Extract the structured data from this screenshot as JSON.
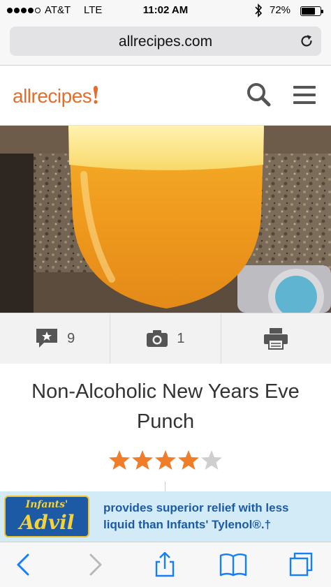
{
  "status_bar": {
    "carrier": "AT&T",
    "network": "LTE",
    "time": "11:02 AM",
    "battery_percent": "72%",
    "battery_level": 0.72,
    "signal_bars_filled": 4,
    "signal_bars_total": 5,
    "icons": [
      "signal-dots-icon",
      "bluetooth-icon",
      "battery-icon"
    ]
  },
  "browser": {
    "url": "allrecipes.com",
    "icons": [
      "reload-icon"
    ]
  },
  "site_header": {
    "logo_text": "allrecipes",
    "logo_color": "#e56d2b",
    "icons": [
      "search-icon",
      "hamburger-menu-icon"
    ]
  },
  "recipe": {
    "title": "Non-Alcoholic New Years Eve Punch",
    "rating": 4,
    "rating_max": 5,
    "star_color": "#f07d2a",
    "star_empty_color": "#cfcfcf"
  },
  "actions": {
    "reviews_count": "9",
    "photos_count": "1",
    "icons": [
      "review-icon",
      "camera-icon",
      "print-icon"
    ]
  },
  "ad": {
    "brand_top": "Infants'",
    "brand": "Advil",
    "line1": "provides superior relief with less",
    "line2": "liquid than Infants' Tylenol®.†",
    "brand_color": "#1c5aa6",
    "background": "#d3ebf7"
  },
  "toolbar": {
    "icons": [
      "back-icon",
      "forward-icon",
      "share-icon",
      "bookmarks-icon",
      "tabs-icon"
    ],
    "accent": "#157efb"
  }
}
